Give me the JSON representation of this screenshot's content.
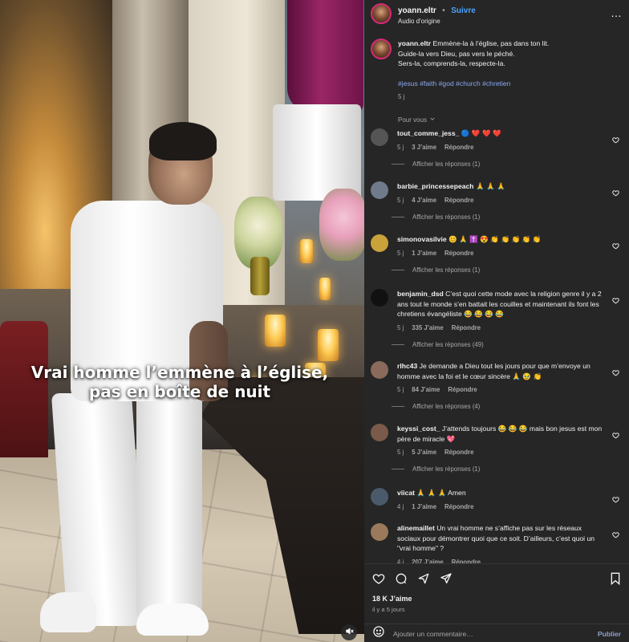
{
  "post": {
    "username": "yoann.eltr",
    "separator": "•",
    "follow_label": "Suivre",
    "audio": "Audio d'origine",
    "more": "…",
    "video_caption_line1": "Vrai homme l’emmène à l’église,",
    "video_caption_line2": "pas en boîte de nuit",
    "caption": {
      "username": "yoann.eltr",
      "line1": "Emmène-la à l’église, pas dans ton lit.",
      "line2": "Guide-la vers Dieu, pas vers le péché.",
      "line3": "Sers-la, comprends-la, respecte-la.",
      "hashtags": "#jesus #faith #god #church #chretien",
      "time": "5 j"
    },
    "for_you": "Pour vous",
    "likes": "18 K J’aime",
    "posted_ago": "il y a 5 jours",
    "add_comment_placeholder": "Ajouter un commentaire…",
    "publish_label": "Publier"
  },
  "comments": [
    {
      "user": "tout_comme_jess_",
      "text": "🔵 ❤️ ❤️ ❤️",
      "time": "5 j",
      "likes": "3 J’aime",
      "reply": "Répondre",
      "view_replies": "Afficher les réponses (1)",
      "avatar": "#555555"
    },
    {
      "user": "barbie_princessepeach",
      "text": "🙏 🙏 🙏",
      "time": "5 j",
      "likes": "4 J’aime",
      "reply": "Répondre",
      "view_replies": "Afficher les réponses (1)",
      "avatar": "#6f7a8a"
    },
    {
      "user": "simonovasilvie",
      "text": "😊 🙏 ✝️ 😍 👏 👏 👏 👏 👏",
      "time": "5 j",
      "likes": "1 J’aime",
      "reply": "Répondre",
      "view_replies": "Afficher les réponses (1)",
      "avatar": "#c9a23a"
    },
    {
      "user": "benjamin_dsd",
      "text": "C’est quoi cette mode avec la religion genre il y a 2 ans tout le monde s’en battait les couilles et maintenant ils font les chretiens évangéliste 😂 😂 😂 😂",
      "time": "5 j",
      "likes": "335 J’aime",
      "reply": "Répondre",
      "view_replies": "Afficher les réponses (49)",
      "avatar": "#111111"
    },
    {
      "user": "rlhc43",
      "text": "Je demande a Dieu tout les jours pour que m’envoye un homme avec la foi et le cœur sincère 🙏 🥹 👏",
      "time": "5 j",
      "likes": "84 J’aime",
      "reply": "Répondre",
      "view_replies": "Afficher les réponses (4)",
      "avatar": "#8a6a5a"
    },
    {
      "user": "keyssi_cost_",
      "text": "J’attends toujours 😂 😂 😂 mais bon jesus est mon père de miracle 💖",
      "time": "5 j",
      "likes": "5 J’aime",
      "reply": "Répondre",
      "view_replies": "Afficher les réponses (1)",
      "avatar": "#7a5a4a"
    },
    {
      "user": "viicat",
      "text": "🙏 🙏 🙏 Amen",
      "time": "4 j",
      "likes": "1 J’aime",
      "reply": "Répondre",
      "view_replies": "",
      "avatar": "#4a5a6a"
    },
    {
      "user": "alinemaillet",
      "text": "Un vrai homme ne s’affiche pas sur les réseaux sociaux pour démontrer quoi que ce soit. D’ailleurs, c’est quoi un \"vrai homme\" ?",
      "time": "4 j",
      "likes": "207 J’aime",
      "reply": "Répondre",
      "view_replies": "",
      "avatar": "#9a7a5a"
    }
  ],
  "colors": {
    "panel_bg": "#262626",
    "link_blue": "#4aa3ff",
    "hashtag": "#8aa9f2",
    "muted": "#a8a8a8",
    "story_ring": "#d62976"
  },
  "icons": [
    "more-icon",
    "heart-icon",
    "comment-icon",
    "share-icon",
    "send-icon",
    "bookmark-icon",
    "emoji-icon",
    "mute-icon",
    "chevron-down-icon",
    "verified-icon"
  ]
}
